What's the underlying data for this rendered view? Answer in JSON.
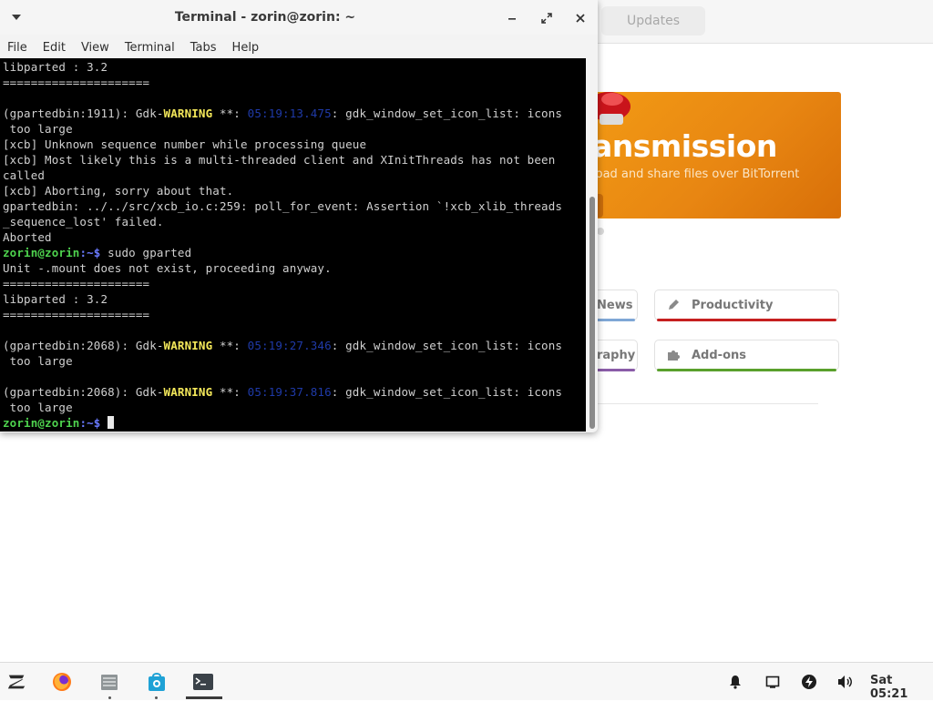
{
  "software_center": {
    "tab_updates": "Updates",
    "banner": {
      "title": "ansmission",
      "subtitle": "load and share files over BitTorrent"
    },
    "categories": [
      {
        "label": "News",
        "color": "#7fa7d6"
      },
      {
        "label": "raphy",
        "color": "#8a5ca8"
      },
      {
        "label": "Productivity",
        "color": "#c61f1f"
      },
      {
        "label": "Add-ons",
        "color": "#5aa02c"
      }
    ]
  },
  "terminal": {
    "title": "Terminal - zorin@zorin: ~",
    "menu": [
      "File",
      "Edit",
      "View",
      "Terminal",
      "Tabs",
      "Help"
    ],
    "prompt_user": "zorin@zorin",
    "prompt_suffix": ":~$",
    "lines": {
      "l1": "libparted : 3.2",
      "l2": "=====================",
      "l3_pre": "(gpartedbin:1911): Gdk-",
      "warning": "WARNING",
      "l3_mid": " **: ",
      "l3_ts": "05:19:13.475",
      "l3_post": ": gdk_window_set_icon_list: icons",
      "too_large": " too large",
      "l5": "[xcb] Unknown sequence number while processing queue",
      "l6": "[xcb] Most likely this is a multi-threaded client and XInitThreads has not been",
      "l7": "called",
      "l8": "[xcb] Aborting, sorry about that.",
      "l9": "gpartedbin: ../../src/xcb_io.c:259: poll_for_event: Assertion `!xcb_xlib_threads",
      "l10": "_sequence_lost' failed.",
      "l11": "Aborted",
      "cmd": " sudo gparted",
      "l13": "Unit -.mount does not exist, proceeding anyway.",
      "l14": "=====================",
      "l15": "libparted : 3.2",
      "l16": "=====================",
      "l18_pre": "(gpartedbin:2068): Gdk-",
      "l18_ts": "05:19:27.346",
      "l21_ts": "05:19:37.816"
    }
  },
  "taskbar": {
    "clock": "Sat 05:21",
    "apps": [
      "zorin-menu",
      "firefox",
      "files",
      "software",
      "terminal"
    ]
  }
}
